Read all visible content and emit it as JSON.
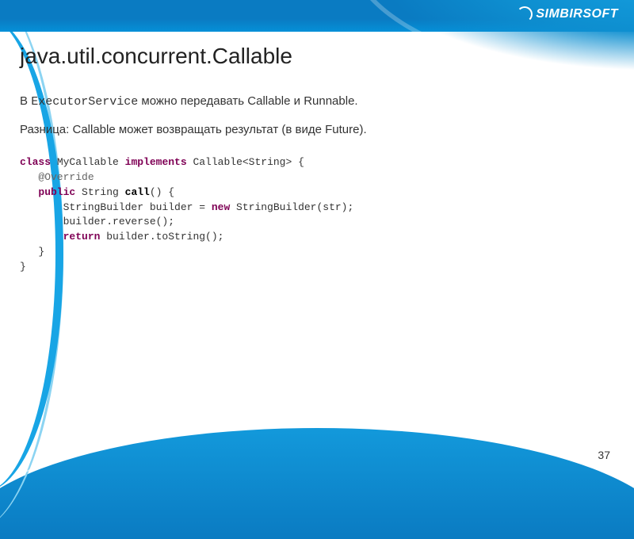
{
  "logo_text": "SIMBIRSOFT",
  "title": "java.util.concurrent.Callable",
  "line1_prefix": "В ",
  "line1_mono": "ExecutorService",
  "line1_suffix": "  можно передавать Callable и Runnable.",
  "line2": "Разница: Callable может возвращать результат (в виде Future).",
  "code": {
    "kw_class": "class",
    "classname": " MyCallable ",
    "kw_implements": "implements",
    "impl_suffix": " Callable<String> {",
    "annotation": "   @Override",
    "kw_public": "   public",
    "ret_type": " String ",
    "method_name": "call",
    "method_parens": "() {",
    "body1": "       StringBuilder builder = ",
    "kw_new": "new",
    "body1b": " StringBuilder(str);",
    "body2": "       builder.reverse();",
    "kw_return": "       return",
    "body3": " builder.toString();",
    "close1": "   }",
    "close2": "}"
  },
  "page_number": "37"
}
